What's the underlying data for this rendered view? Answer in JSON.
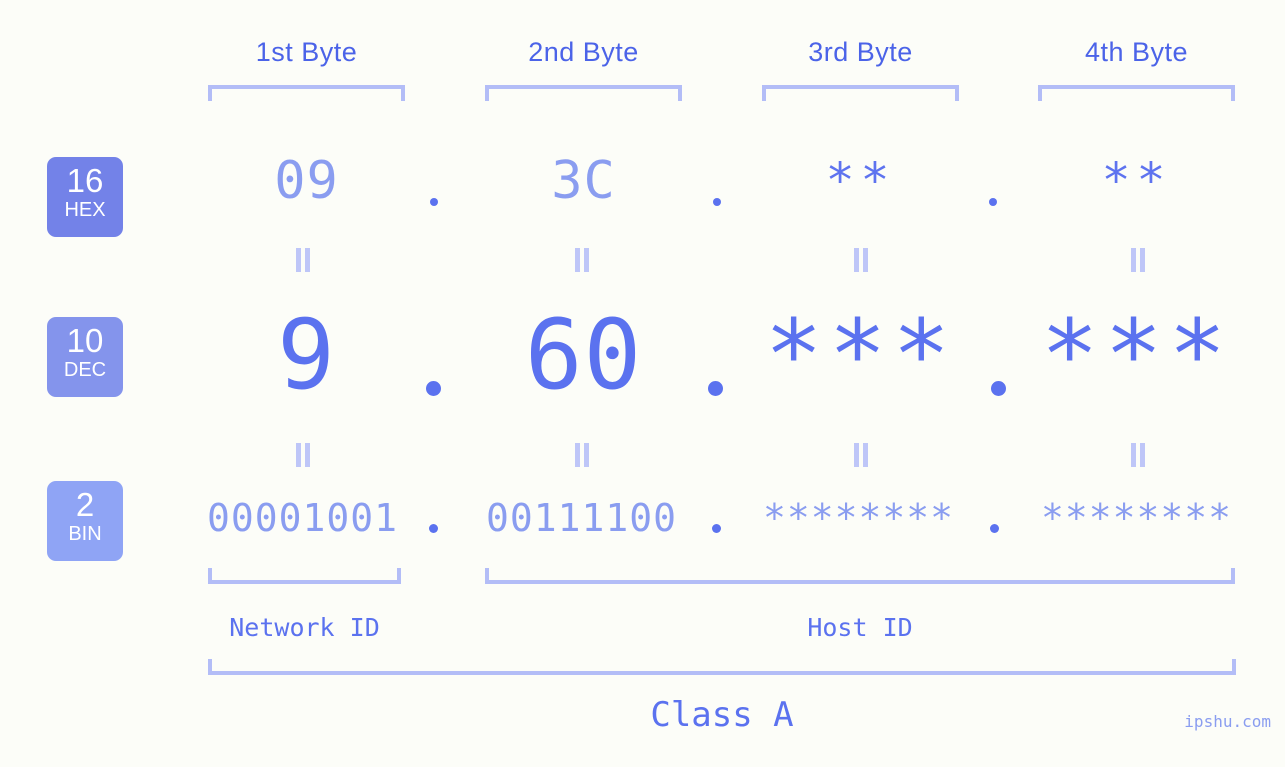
{
  "diagram": {
    "title_class": "Class A",
    "watermark": "ipshu.com",
    "byte_headers": [
      {
        "label": "1st Byte"
      },
      {
        "label": "2nd Byte"
      },
      {
        "label": "3rd Byte"
      },
      {
        "label": "4th Byte"
      }
    ],
    "radix_badges": [
      {
        "number": "16",
        "label": "HEX",
        "color": "#7382e8"
      },
      {
        "number": "10",
        "label": "DEC",
        "color": "#8494ec"
      },
      {
        "number": "2",
        "label": "BIN",
        "color": "#8fa4f5"
      }
    ],
    "rows": {
      "hex": {
        "values": [
          "09",
          "3C",
          "**",
          "**"
        ],
        "masked": [
          false,
          false,
          true,
          true
        ]
      },
      "dec": {
        "values": [
          "9",
          "60",
          "***",
          "***"
        ],
        "masked": [
          false,
          false,
          true,
          true
        ]
      },
      "bin": {
        "values": [
          "00001001",
          "00111100",
          "********",
          "********"
        ],
        "masked": [
          false,
          false,
          true,
          true
        ]
      }
    },
    "separators": {
      "hex": ".",
      "dec": ".",
      "bin": "."
    },
    "id_labels": {
      "network": "Network ID",
      "host": "Host ID"
    },
    "colors": {
      "background": "#fcfdf8",
      "header_text": "#4b63e8",
      "bracket": "#b3bdf7",
      "value_light": "#8a9df0",
      "value_strong": "#5b72ef",
      "equals": "#bec6f8"
    }
  }
}
